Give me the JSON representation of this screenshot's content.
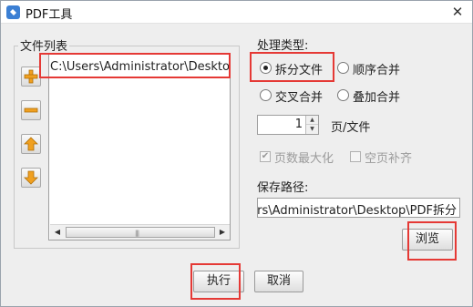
{
  "window": {
    "title": "PDF工具",
    "app_icon": "pdf-tool-icon",
    "close_glyph": "✕"
  },
  "file_list": {
    "label": "文件列表",
    "items": [
      "C:\\Users\\Administrator\\Desktop"
    ],
    "side_buttons": [
      "add-icon",
      "remove-icon",
      "move-up-icon",
      "move-down-icon"
    ]
  },
  "processing": {
    "label": "处理类型:",
    "options": [
      {
        "label": "拆分文件",
        "selected": true
      },
      {
        "label": "顺序合并",
        "selected": false
      },
      {
        "label": "交叉合并",
        "selected": false
      },
      {
        "label": "叠加合并",
        "selected": false
      }
    ],
    "pages_value": "1",
    "pages_unit": "页/文件",
    "checkbox_maximize": {
      "label": "页数最大化",
      "checked": true,
      "enabled": false
    },
    "checkbox_blank": {
      "label": "空页补齐",
      "checked": false,
      "enabled": false
    }
  },
  "save_path": {
    "label": "保存路径:",
    "value": "C:\\Users\\Administrator\\Desktop\\PDF拆分",
    "browse_label": "浏览"
  },
  "footer": {
    "execute_label": "执行",
    "cancel_label": "取消"
  },
  "colors": {
    "highlight": "#e53935",
    "title_icon": "#3b7fd4",
    "arrow_icon": "#f0a020"
  }
}
